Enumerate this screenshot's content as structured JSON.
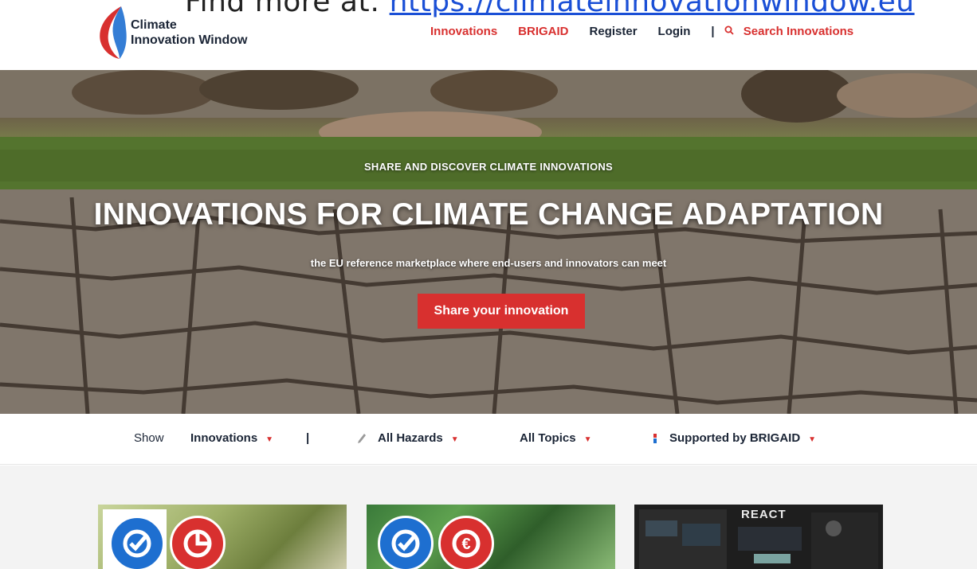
{
  "overlay": {
    "prefix": "Find more at: ",
    "link": "https://climateinnovationwindow.eu"
  },
  "header": {
    "logo_line1": "Climate",
    "logo_line2": "Innovation Window",
    "nav": {
      "innovations": "Innovations",
      "brigaid": "BRIGAID",
      "register": "Register",
      "login": "Login",
      "separator": "|",
      "search": "Search Innovations"
    }
  },
  "hero": {
    "kicker": "SHARE AND DISCOVER CLIMATE INNOVATIONS",
    "title": "INNOVATIONS FOR CLIMATE CHANGE ADAPTATION",
    "subtitle": "the EU reference marketplace where end-users and innovators can meet",
    "cta": "Share your innovation"
  },
  "filters": {
    "show_label": "Show",
    "type": "Innovations",
    "separator": "|",
    "hazards": "All Hazards",
    "topics": "All Topics",
    "support": "Supported by BRIGAID"
  },
  "cards": [
    {
      "badges": [
        "check-icon",
        "pie-chart-icon"
      ]
    },
    {
      "badges": [
        "check-icon",
        "euro-icon"
      ]
    },
    {
      "heading": "REACT"
    }
  ],
  "colors": {
    "accent_red": "#d8302f",
    "badge_blue": "#1e6fd0",
    "text_dark": "#1b2536"
  }
}
